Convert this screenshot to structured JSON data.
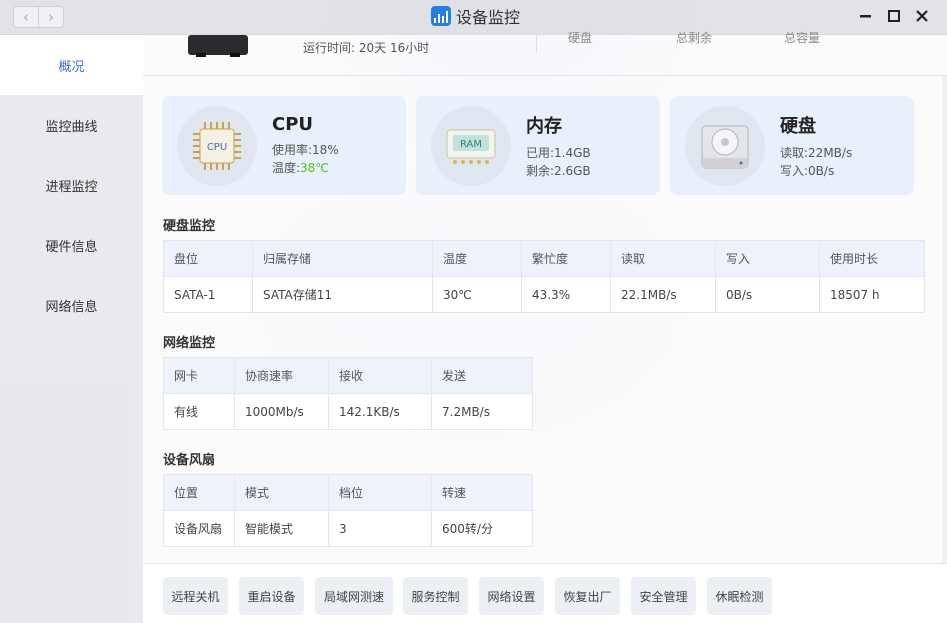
{
  "window": {
    "title": "设备监控"
  },
  "sidebar": {
    "items": [
      {
        "label": "概况"
      },
      {
        "label": "监控曲线"
      },
      {
        "label": "进程监控"
      },
      {
        "label": "硬件信息"
      },
      {
        "label": "网络信息"
      }
    ]
  },
  "top": {
    "uptime_label": "运行时间:",
    "uptime_value": "20天 16小时",
    "cut_labels": [
      "硬盘",
      "总剩余",
      "总容量"
    ]
  },
  "cards": {
    "cpu": {
      "title": "CPU",
      "icon_text": "CPU",
      "usage_label": "使用率:",
      "usage": "18%",
      "temp_label": "温度:",
      "temp": "38℃"
    },
    "memory": {
      "title": "内存",
      "icon_text": "RAM",
      "used_label": "已用:",
      "used": "1.4GB",
      "free_label": "剩余:",
      "free": "2.6GB"
    },
    "disk": {
      "title": "硬盘",
      "read_label": "读取:",
      "read": "22MB/s",
      "write_label": "写入:",
      "write": "0B/s"
    }
  },
  "disk_monitor": {
    "title": "硬盘监控",
    "headers": [
      "盘位",
      "归属存储",
      "温度",
      "繁忙度",
      "读取",
      "写入",
      "使用时长"
    ],
    "rows": [
      [
        "SATA-1",
        "SATA存储11",
        "30℃",
        "43.3%",
        "22.1MB/s",
        "0B/s",
        "18507 h"
      ]
    ]
  },
  "network_monitor": {
    "title": "网络监控",
    "headers": [
      "网卡",
      "协商速率",
      "接收",
      "发送"
    ],
    "rows": [
      [
        "有线",
        "1000Mb/s",
        "142.1KB/s",
        "7.2MB/s"
      ]
    ]
  },
  "fan": {
    "title": "设备风扇",
    "headers": [
      "位置",
      "模式",
      "档位",
      "转速"
    ],
    "rows": [
      [
        "设备风扇",
        "智能模式",
        "3",
        "600转/分"
      ]
    ]
  },
  "actions": [
    "远程关机",
    "重启设备",
    "局域网测速",
    "服务控制",
    "网络设置",
    "恢复出厂",
    "安全管理",
    "休眠检测"
  ],
  "colors": {
    "accent": "#3e6ee8",
    "temp_ok": "#52c41a",
    "card_bg": "#e8f0fb",
    "table_head": "#eef3fb"
  }
}
